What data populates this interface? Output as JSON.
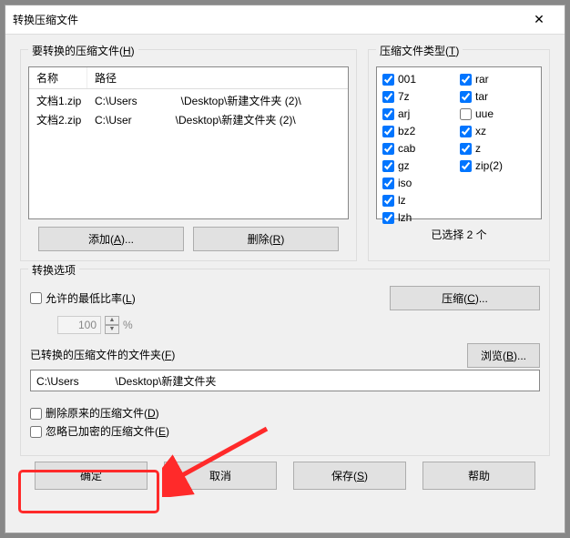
{
  "title": "转换压缩文件",
  "filesGroup": {
    "legend": "要转换的压缩文件(H)",
    "headers": {
      "name": "名称",
      "path": "路径"
    },
    "rows": [
      {
        "name": "文档1.zip",
        "path_a": "C:\\Users",
        "path_b": "Desktop\\新建文件夹 (2)\\"
      },
      {
        "name": "文档2.zip",
        "path_a": "C:\\User",
        "path_b": "Desktop\\新建文件夹 (2)\\"
      }
    ],
    "addBtn": "添加(A)...",
    "delBtn": "删除(R)"
  },
  "typesGroup": {
    "legend": "压缩文件类型(T)",
    "col1": [
      {
        "label": "001",
        "checked": true
      },
      {
        "label": "7z",
        "checked": true
      },
      {
        "label": "arj",
        "checked": true
      },
      {
        "label": "bz2",
        "checked": true
      },
      {
        "label": "cab",
        "checked": true
      },
      {
        "label": "gz",
        "checked": true
      },
      {
        "label": "iso",
        "checked": true
      },
      {
        "label": "lz",
        "checked": true
      },
      {
        "label": "lzh",
        "checked": true
      }
    ],
    "col2": [
      {
        "label": "rar",
        "checked": true
      },
      {
        "label": "tar",
        "checked": true
      },
      {
        "label": "uue",
        "checked": false
      },
      {
        "label": "xz",
        "checked": true
      },
      {
        "label": "z",
        "checked": true
      },
      {
        "label": "zip(2)",
        "checked": true
      }
    ],
    "selectedText": "已选择 2 个"
  },
  "options": {
    "legend": "转换选项",
    "allowRatio": {
      "label": "允许的最低比率(L)",
      "checked": false,
      "value": "100",
      "percent": "%"
    },
    "compressBtn": "压缩(C)...",
    "folder": {
      "label": "已转换的压缩文件的文件夹(F)",
      "value_a": "C:\\Users",
      "value_b": "\\Desktop\\新建文件夹",
      "browseBtn": "浏览(B)..."
    },
    "deleteOrig": {
      "label": "删除原来的压缩文件(D)",
      "checked": false
    },
    "ignoreEnc": {
      "label": "忽略已加密的压缩文件(E)",
      "checked": false
    }
  },
  "footer": {
    "ok": "确定",
    "cancel": "取消",
    "save": "保存(S)",
    "help": "帮助"
  }
}
